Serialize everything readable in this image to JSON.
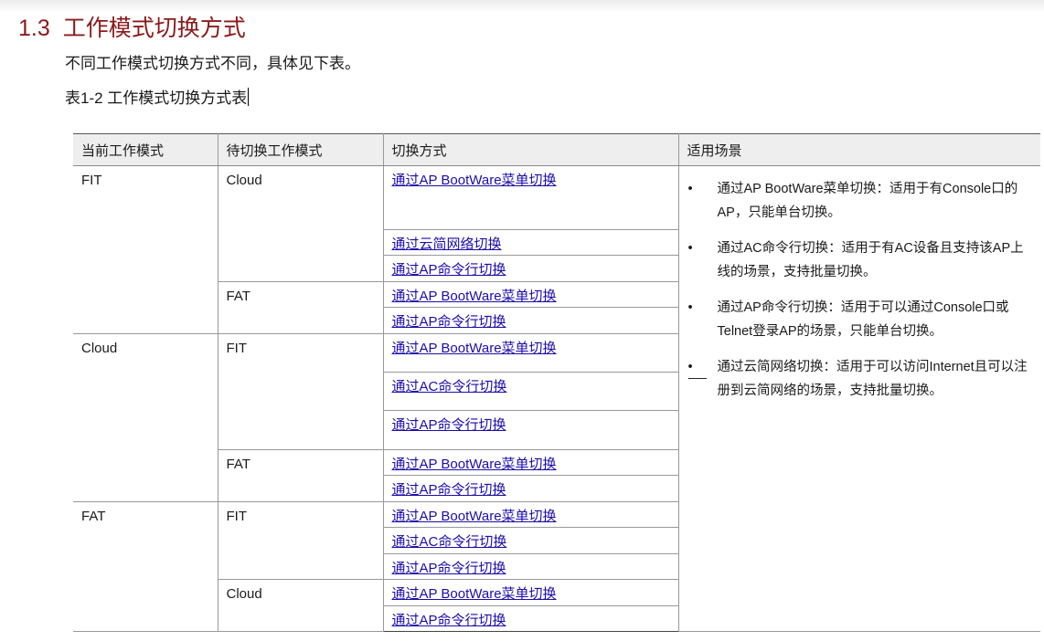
{
  "section": {
    "number": "1.3",
    "title": "工作模式切换方式"
  },
  "intro_text": "不同工作模式切换方式不同，具体见下表。",
  "table_caption": "表1-2 工作模式切换方式表",
  "table": {
    "headers": [
      "当前工作模式",
      "待切换工作模式",
      "切换方式",
      "适用场景"
    ],
    "groups": [
      {
        "current": "FIT",
        "targets": [
          {
            "target": "Cloud",
            "methods": [
              "通过AP BootWare菜单切换",
              "通过云简网络切换",
              "通过AP命令行切换"
            ]
          },
          {
            "target": "FAT",
            "methods": [
              "通过AP BootWare菜单切换",
              "通过AP命令行切换"
            ]
          }
        ]
      },
      {
        "current": "Cloud",
        "targets": [
          {
            "target": "FIT",
            "methods": [
              "通过AP BootWare菜单切换",
              "通过AC命令行切换",
              "通过AP命令行切换"
            ]
          },
          {
            "target": "FAT",
            "methods": [
              "通过AP BootWare菜单切换",
              "通过AP命令行切换"
            ]
          }
        ]
      },
      {
        "current": "FAT",
        "targets": [
          {
            "target": "FIT",
            "methods": [
              "通过AP BootWare菜单切换",
              "通过AC命令行切换",
              "通过AP命令行切换"
            ]
          },
          {
            "target": "Cloud",
            "methods": [
              "通过AP BootWare菜单切换",
              "通过AP命令行切换"
            ]
          }
        ]
      }
    ],
    "scenarios": [
      "通过AP BootWare菜单切换：适用于有Console口的AP，只能单台切换。",
      "通过AC命令行切换：适用于有AC设备且支持该AP上线的场景，支持批量切换。",
      "通过AP命令行切换：适用于可以通过Console口或Telnet登录AP的场景，只能单台切换。",
      "通过云简网络切换：适用于可以访问Internet且可以注册到云简网络的场景，支持批量切换。"
    ],
    "bullet": "•"
  }
}
